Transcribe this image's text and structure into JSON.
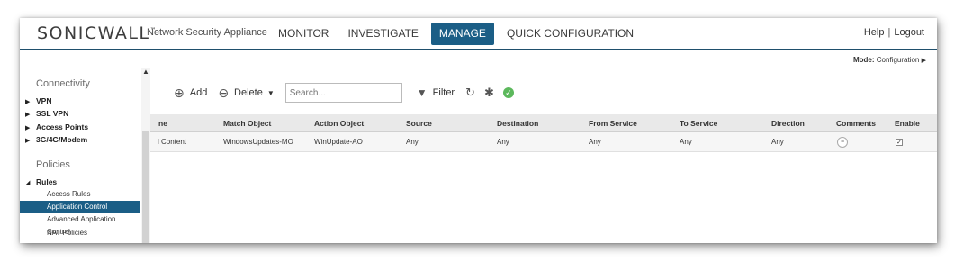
{
  "header": {
    "logo_text": "SONICWALL",
    "logo_mark": "™",
    "app_name": "Network Security Appliance",
    "nav": [
      "MONITOR",
      "INVESTIGATE",
      "MANAGE",
      "QUICK CONFIGURATION"
    ],
    "active_nav": "MANAGE",
    "help": "Help",
    "separator": "|",
    "logout": "Logout"
  },
  "mode": {
    "label": "Mode:",
    "value": "Configuration"
  },
  "sidebar": {
    "group_connectivity": "Connectivity",
    "connectivity_items": [
      "VPN",
      "SSL VPN",
      "Access Points",
      "3G/4G/Modem"
    ],
    "group_policies": "Policies",
    "rules_label": "Rules",
    "rules_items": [
      "Access Rules",
      "Application Control",
      "Advanced Application Control",
      "NAT Policies"
    ],
    "active_item": "Application Control"
  },
  "toolbar": {
    "add": "Add",
    "delete": "Delete",
    "search_placeholder": "Search...",
    "filter": "Filter"
  },
  "table": {
    "columns": [
      "ne",
      "Match Object",
      "Action Object",
      "Source",
      "Destination",
      "From Service",
      "To Service",
      "Direction",
      "Comments",
      "Enable"
    ],
    "rows": [
      {
        "name": "l Content",
        "match_object": "WindowsUpdates-MO",
        "action_object": "WinUpdate-AO",
        "source": "Any",
        "destination": "Any",
        "from_service": "Any",
        "to_service": "Any",
        "direction": "Any",
        "comments": "",
        "enabled": true
      }
    ]
  },
  "colors": {
    "accent": "#1b5e86",
    "status_ok": "#5cb85c"
  }
}
